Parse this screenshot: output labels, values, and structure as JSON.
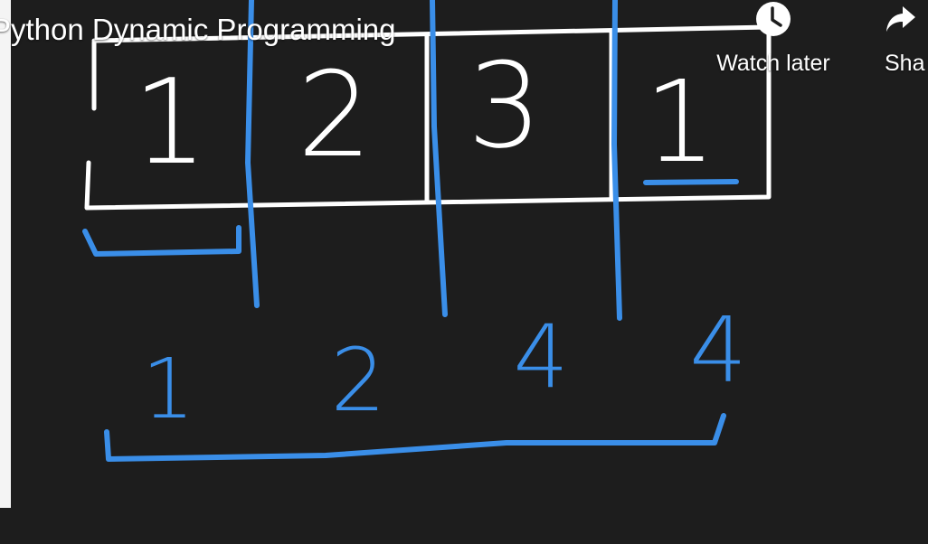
{
  "video": {
    "title": "Python Dynamic Programming"
  },
  "overlay_actions": {
    "watch_later_label": "Watch later",
    "share_label": "Sha",
    "watch_later_icon": "clock-icon",
    "share_icon": "share-arrow-icon"
  },
  "whiteboard": {
    "array_cells": [
      "1",
      "2",
      "3",
      "1"
    ],
    "dp_values": [
      "1",
      "2",
      "4",
      "4"
    ]
  },
  "colors": {
    "background": "#1d1d1d",
    "ink_white": "#ffffff",
    "ink_blue": "#3a8ee8"
  }
}
